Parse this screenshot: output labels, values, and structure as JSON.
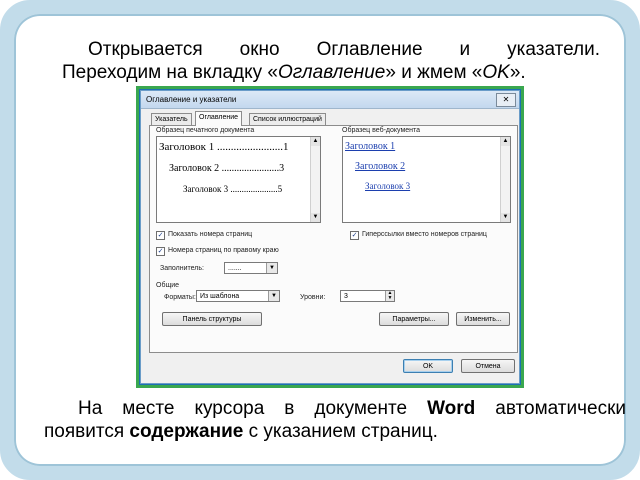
{
  "slide": {
    "para1_line1": "Открывается окно Оглавление и указатели.",
    "para1_line2_pre": "Переходим на вкладку «",
    "para1_line2_it": "Оглавление",
    "para1_line2_mid": "» и жмем «",
    "para1_line2_ok": "OK",
    "para1_line2_post": "».",
    "para2_line1_pre": "На месте курсора в документе ",
    "para2_line1_bold": "Word",
    "para2_line1_post": " автоматически",
    "para2_line2_pre": "появится ",
    "para2_line2_bold": "содержание",
    "para2_line2_post": " с указанием страниц."
  },
  "dialog": {
    "title": "Оглавление и указатели",
    "close_glyph": "✕",
    "tabs": [
      "Указатель",
      "Оглавление",
      "Список иллюстраций"
    ],
    "print_preview_label": "Образец печатного документа",
    "web_preview_label": "Образец веб-документа",
    "print_preview": [
      "Заголовок 1 ........................1",
      "Заголовок 2 .......................3",
      "Заголовок 3 .....................5"
    ],
    "web_preview": [
      "Заголовок 1",
      "Заголовок 2",
      "Заголовок 3"
    ],
    "checkbox_show_page_numbers": "Показать номера страниц",
    "checkbox_right_align": "Номера страниц по правому краю",
    "checkbox_hyperlinks": "Гиперссылки вместо номеров страниц",
    "fill_label": "Заполнитель:",
    "fill_value": ".......",
    "general_label": "Общие",
    "formats_label": "Форматы:",
    "formats_value": "Из шаблона",
    "levels_label": "Уровни:",
    "levels_value": "3",
    "btn_outline": "Панель структуры",
    "btn_options": "Параметры...",
    "btn_modify": "Изменить...",
    "btn_ok": "OK",
    "btn_cancel": "Отмена",
    "check_glyph": "✓",
    "dropdown_glyph": "▼",
    "spin_up_glyph": "▲",
    "spin_down_glyph": "▼"
  }
}
